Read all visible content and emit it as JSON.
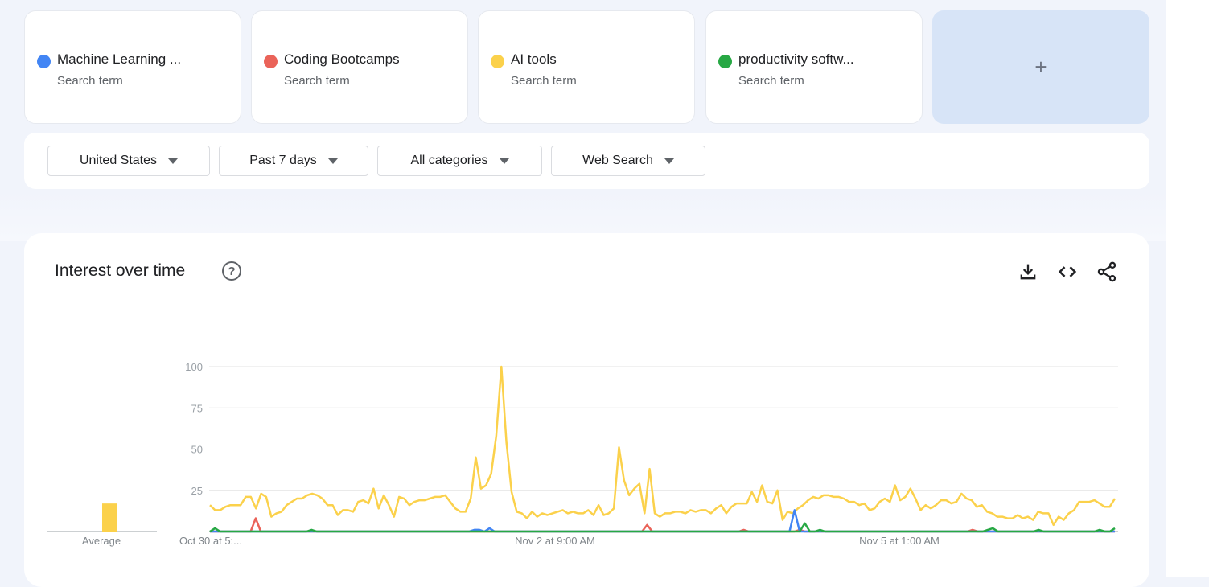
{
  "search_terms": [
    {
      "label": "Machine Learning ...",
      "sublabel": "Search term",
      "color": "#4285f4"
    },
    {
      "label": "Coding Bootcamps",
      "sublabel": "Search term",
      "color": "#ea6359"
    },
    {
      "label": "AI tools",
      "sublabel": "Search term",
      "color": "#fbd14b"
    },
    {
      "label": "productivity softw...",
      "sublabel": "Search term",
      "color": "#27a844"
    }
  ],
  "add_button": {
    "label": "+"
  },
  "filters": {
    "region": "United States",
    "period": "Past 7 days",
    "category": "All categories",
    "search_type": "Web Search"
  },
  "chart_panel": {
    "title": "Interest over time",
    "help_icon": "help-circle-icon",
    "tools": [
      "download-icon",
      "embed-code-icon",
      "share-icon"
    ]
  },
  "chart_data": {
    "type": "line",
    "ylim": [
      0,
      100
    ],
    "yticks": [
      "100",
      "75",
      "50",
      "25"
    ],
    "xtick_labels": [
      "Oct 30 at 5:...",
      "Nov 2 at 9:00 AM",
      "Nov 5 at 1:00 AM"
    ],
    "average_label": "Average",
    "averages": [
      0,
      0,
      17,
      0
    ],
    "series": [
      {
        "name": "AI tools",
        "color": "#fbd14b",
        "values": [
          16,
          13,
          13,
          15,
          16,
          16,
          16,
          21,
          21,
          14,
          23,
          21,
          9,
          11,
          12,
          16,
          18,
          20,
          20,
          22,
          23,
          22,
          20,
          16,
          16,
          10,
          13,
          13,
          12,
          18,
          19,
          17,
          26,
          14,
          22,
          16,
          9,
          21,
          20,
          16,
          18,
          19,
          19,
          20,
          21,
          21,
          22,
          18,
          14,
          12,
          12,
          20,
          45,
          26,
          28,
          35,
          58,
          100,
          54,
          24,
          12,
          11,
          8,
          12,
          9,
          11,
          10,
          11,
          12,
          13,
          11,
          12,
          11,
          11,
          13,
          10,
          16,
          10,
          11,
          14,
          51,
          31,
          22,
          26,
          29,
          11,
          38,
          11,
          9,
          11,
          11,
          12,
          12,
          11,
          13,
          12,
          13,
          13,
          11,
          14,
          16,
          11,
          15,
          17,
          17,
          17,
          24,
          18,
          28,
          18,
          17,
          25,
          7,
          12,
          11,
          14,
          16,
          19,
          21,
          20,
          22,
          22,
          21,
          21,
          20,
          18,
          18,
          16,
          17,
          13,
          14,
          18,
          20,
          18,
          28,
          19,
          21,
          26,
          20,
          13,
          16,
          14,
          16,
          19,
          19,
          17,
          18,
          23,
          20,
          19,
          15,
          16,
          12,
          11,
          9,
          9,
          8,
          8,
          10,
          8,
          9,
          7,
          12,
          11,
          11,
          4,
          9,
          7,
          11,
          13,
          18,
          18,
          18,
          19,
          17,
          15,
          15,
          20
        ]
      },
      {
        "name": "Machine Learning ...",
        "color": "#4285f4",
        "values": [
          0,
          0,
          0,
          0,
          0,
          0,
          0,
          0,
          0,
          0,
          0,
          0,
          0,
          0,
          0,
          0,
          0,
          0,
          0,
          0,
          0,
          0,
          0,
          0,
          0,
          0,
          0,
          0,
          0,
          0,
          0,
          0,
          0,
          0,
          0,
          0,
          0,
          0,
          0,
          0,
          0,
          0,
          0,
          0,
          0,
          0,
          0,
          0,
          0,
          0,
          0,
          0,
          1,
          1,
          0,
          2,
          0,
          0,
          0,
          0,
          0,
          0,
          0,
          0,
          0,
          0,
          0,
          0,
          0,
          0,
          0,
          0,
          0,
          0,
          0,
          0,
          0,
          0,
          0,
          0,
          0,
          0,
          0,
          0,
          0,
          0,
          0,
          0,
          0,
          0,
          0,
          0,
          0,
          0,
          0,
          0,
          0,
          0,
          0,
          0,
          0,
          0,
          0,
          0,
          0,
          0,
          0,
          0,
          0,
          0,
          0,
          0,
          0,
          0,
          0,
          13,
          0,
          0,
          0,
          0,
          0,
          0,
          0,
          0,
          0,
          0,
          0,
          0,
          0,
          0,
          0,
          0,
          0,
          0,
          0,
          0,
          0,
          0,
          0,
          0,
          0,
          0,
          0,
          0,
          0,
          0,
          0,
          0,
          0,
          0,
          0,
          0,
          0,
          0,
          0,
          0,
          0,
          0,
          0,
          0,
          0,
          0,
          0,
          0,
          0,
          0,
          0,
          0,
          0,
          0,
          0,
          0,
          0,
          0,
          0,
          0,
          0,
          0,
          0
        ]
      },
      {
        "name": "Coding Bootcamps",
        "color": "#ea6359",
        "values": [
          0,
          0,
          0,
          0,
          0,
          0,
          0,
          0,
          0,
          8,
          0,
          0,
          0,
          0,
          0,
          0,
          0,
          0,
          0,
          0,
          0,
          0,
          0,
          0,
          0,
          0,
          0,
          0,
          0,
          0,
          0,
          0,
          0,
          0,
          0,
          0,
          0,
          0,
          0,
          0,
          0,
          0,
          0,
          0,
          0,
          0,
          0,
          0,
          0,
          0,
          0,
          0,
          0,
          0,
          0,
          0,
          0,
          0,
          0,
          0,
          0,
          0,
          0,
          0,
          0,
          0,
          0,
          0,
          0,
          0,
          0,
          0,
          0,
          0,
          0,
          0,
          0,
          0,
          0,
          0,
          0,
          0,
          0,
          0,
          0,
          0,
          4,
          0,
          0,
          0,
          0,
          0,
          0,
          0,
          0,
          0,
          0,
          0,
          0,
          0,
          0,
          0,
          0,
          0,
          0,
          1,
          0,
          0,
          0,
          0,
          0,
          0,
          0,
          0,
          0,
          0,
          1,
          0,
          0,
          0,
          0,
          0,
          0,
          0,
          0,
          0,
          0,
          0,
          0,
          0,
          0,
          0,
          0,
          0,
          0,
          0,
          0,
          0,
          0,
          0,
          0,
          0,
          0,
          0,
          0,
          0,
          0,
          0,
          0,
          0,
          1,
          0,
          0,
          0,
          0,
          0,
          0,
          0,
          0,
          0,
          0,
          0,
          0,
          0,
          0,
          0,
          0,
          0,
          0,
          0,
          0,
          0,
          0,
          0,
          0,
          0,
          0,
          0,
          0
        ]
      },
      {
        "name": "productivity softw...",
        "color": "#27a844",
        "values": [
          0,
          2,
          0,
          0,
          0,
          0,
          0,
          0,
          0,
          0,
          0,
          0,
          0,
          0,
          0,
          0,
          0,
          0,
          0,
          0,
          1,
          0,
          0,
          0,
          0,
          0,
          0,
          0,
          0,
          0,
          0,
          0,
          0,
          0,
          0,
          0,
          0,
          0,
          0,
          0,
          0,
          0,
          0,
          0,
          0,
          0,
          0,
          0,
          0,
          0,
          0,
          0,
          0,
          0,
          0,
          0,
          0,
          0,
          0,
          0,
          0,
          0,
          0,
          0,
          0,
          0,
          0,
          0,
          0,
          0,
          0,
          0,
          0,
          0,
          0,
          0,
          0,
          0,
          0,
          0,
          0,
          0,
          0,
          0,
          0,
          0,
          0,
          0,
          0,
          0,
          0,
          0,
          0,
          0,
          0,
          0,
          0,
          0,
          0,
          0,
          0,
          0,
          0,
          0,
          0,
          0,
          0,
          0,
          0,
          0,
          0,
          0,
          0,
          0,
          0,
          0,
          0,
          5,
          0,
          0,
          1,
          0,
          0,
          0,
          0,
          0,
          0,
          0,
          0,
          0,
          0,
          0,
          0,
          0,
          0,
          0,
          0,
          0,
          0,
          0,
          0,
          0,
          0,
          0,
          0,
          0,
          0,
          0,
          0,
          0,
          0,
          0,
          0,
          1,
          2,
          0,
          0,
          0,
          0,
          0,
          0,
          0,
          0,
          1,
          0,
          0,
          0,
          0,
          0,
          0,
          0,
          0,
          0,
          0,
          0,
          1,
          0,
          0,
          2
        ]
      }
    ]
  }
}
